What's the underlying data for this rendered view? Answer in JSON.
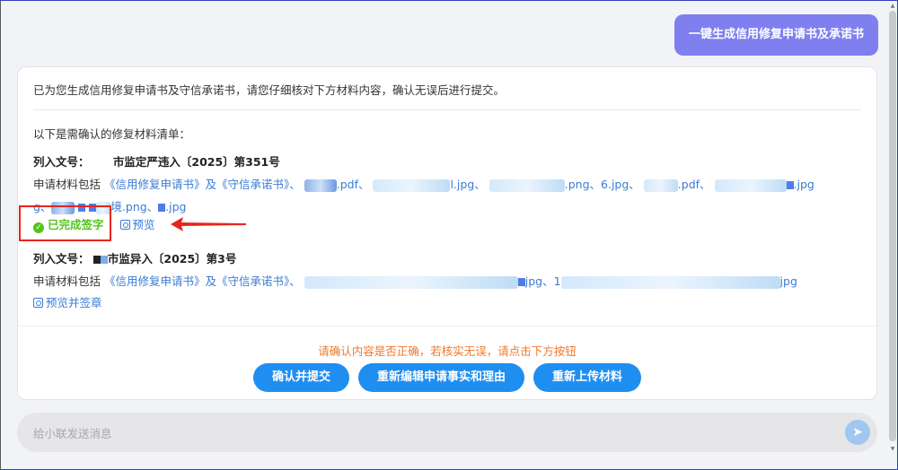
{
  "user_message": "一键生成信用修复申请书及承诺书",
  "card": {
    "intro": "已为您生成信用修复申请书及守信承诺书，请您仔细核对下方材料内容，确认无误后进行提交。",
    "list_title": "以下是需确认的修复材料清单：",
    "items": [
      {
        "doc_label": "列入文号：",
        "doc_number": "市监定严违入〔2025〕第351号",
        "materials_prefix": "申请材料包括",
        "materials_links": "《信用修复申请书》及《守信承诺书》、",
        "file_1": ".pdf、",
        "file_2": "l.jpg、",
        "file_3": ".png、6.jpg、",
        "file_4": ".pdf、",
        "file_5": ".jpg",
        "file_6": "g、",
        "file_7": "境.png、",
        "file_8": ".jpg",
        "status": "已完成签字",
        "action": "预览"
      },
      {
        "doc_label": "列入文号：",
        "doc_number": "市监异入〔2025〕第3号",
        "materials_prefix": "申请材料包括",
        "materials_links": "《信用修复申请书》及《守信承诺书》、",
        "file_1": "jpg、1",
        "file_2": "jpg",
        "action": "预览并签章"
      }
    ],
    "hint": "请确认内容是否正确，若核实无误，请点击下方按钮",
    "buttons": [
      "确认并提交",
      "重新编辑申请事实和理由",
      "重新上传材料"
    ]
  },
  "input": {
    "placeholder": "给小联发送消息"
  },
  "colors": {
    "accent": "#1f8ef1",
    "user_bubble": "#7f7ff0",
    "success": "#52c41a",
    "warning": "#f0782b",
    "highlight": "#e6251e"
  },
  "icons": {
    "status": "check-circle-icon",
    "preview": "scan-icon",
    "send": "paper-plane-icon"
  }
}
